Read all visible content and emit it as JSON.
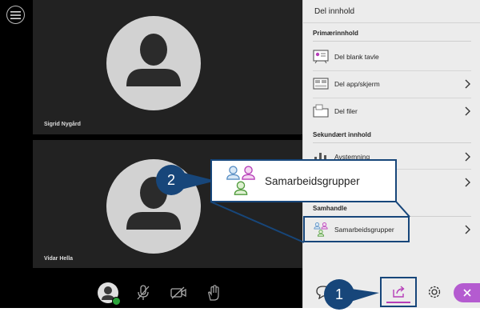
{
  "stage": {
    "participants": [
      {
        "name": "Sigrid Nygård"
      },
      {
        "name": "Vidar Hella"
      }
    ],
    "menu_icon": "hamburger-menu-icon",
    "layout_icon": "layout-toggle-icon",
    "controls": [
      {
        "icon": "user-avatar-icon",
        "status": "online"
      },
      {
        "icon": "microphone-muted-icon"
      },
      {
        "icon": "camera-off-icon"
      },
      {
        "icon": "raise-hand-icon"
      }
    ]
  },
  "panel": {
    "title": "Del innhold",
    "sections": [
      {
        "header": "Primærinnhold",
        "items": [
          {
            "label": "Del blank tavle",
            "icon": "whiteboard-icon",
            "has_chevron": false
          },
          {
            "label": "Del app/skjerm",
            "icon": "screen-share-icon",
            "has_chevron": true
          },
          {
            "label": "Del filer",
            "icon": "folder-icon",
            "has_chevron": true
          }
        ]
      },
      {
        "header": "Sekundært innhold",
        "items": [
          {
            "label": "Avstemning",
            "icon": "poll-icon",
            "has_chevron": true
          },
          {
            "label": "",
            "icon": "timer-icon",
            "has_chevron": true
          }
        ]
      },
      {
        "header": "Samhandle",
        "items": [
          {
            "label": "Samarbeidsgrupper",
            "icon": "breakout-groups-icon",
            "has_chevron": true
          }
        ]
      }
    ],
    "footer": {
      "chat_icon": "chat-icon",
      "share_icon": "share-content-icon",
      "settings_icon": "settings-icon",
      "close_icon": "close-icon",
      "accent": "#b63eb8"
    }
  },
  "callouts": {
    "zoom_label": "Samarbeidsgrupper",
    "step_1": "1",
    "step_2": "2",
    "color": "#17467a"
  }
}
